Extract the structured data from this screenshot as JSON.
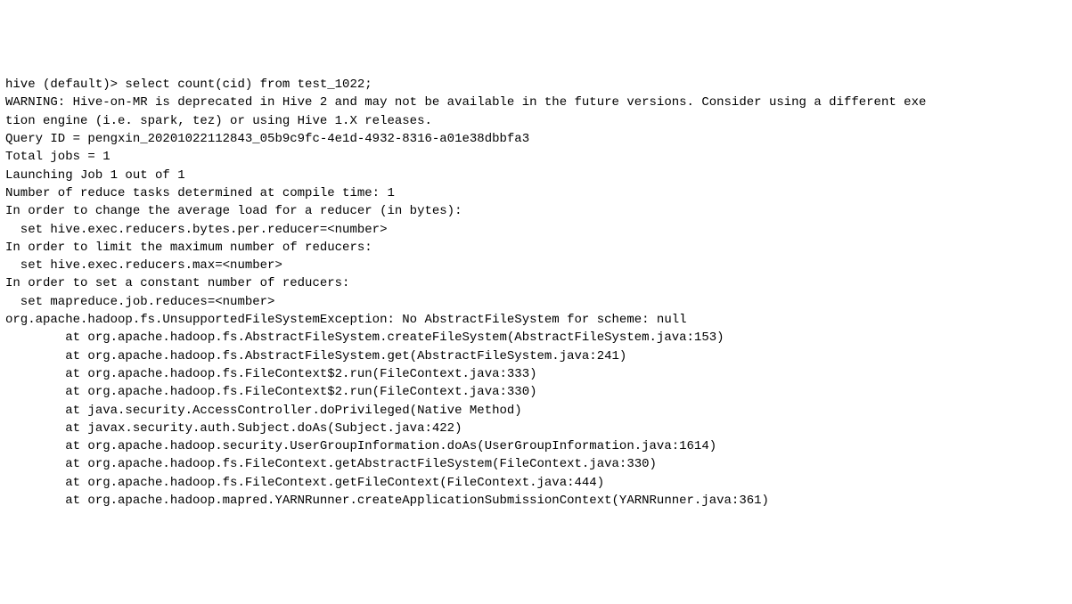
{
  "terminal": {
    "lines": [
      "hive (default)> select count(cid) from test_1022;",
      "WARNING: Hive-on-MR is deprecated in Hive 2 and may not be available in the future versions. Consider using a different exe",
      "tion engine (i.e. spark, tez) or using Hive 1.X releases.",
      "Query ID = pengxin_20201022112843_05b9c9fc-4e1d-4932-8316-a01e38dbbfa3",
      "Total jobs = 1",
      "Launching Job 1 out of 1",
      "Number of reduce tasks determined at compile time: 1",
      "In order to change the average load for a reducer (in bytes):",
      "  set hive.exec.reducers.bytes.per.reducer=<number>",
      "In order to limit the maximum number of reducers:",
      "  set hive.exec.reducers.max=<number>",
      "In order to set a constant number of reducers:",
      "  set mapreduce.job.reduces=<number>",
      "org.apache.hadoop.fs.UnsupportedFileSystemException: No AbstractFileSystem for scheme: null",
      "        at org.apache.hadoop.fs.AbstractFileSystem.createFileSystem(AbstractFileSystem.java:153)",
      "        at org.apache.hadoop.fs.AbstractFileSystem.get(AbstractFileSystem.java:241)",
      "        at org.apache.hadoop.fs.FileContext$2.run(FileContext.java:333)",
      "        at org.apache.hadoop.fs.FileContext$2.run(FileContext.java:330)",
      "        at java.security.AccessController.doPrivileged(Native Method)",
      "        at javax.security.auth.Subject.doAs(Subject.java:422)",
      "        at org.apache.hadoop.security.UserGroupInformation.doAs(UserGroupInformation.java:1614)",
      "        at org.apache.hadoop.fs.FileContext.getAbstractFileSystem(FileContext.java:330)",
      "        at org.apache.hadoop.fs.FileContext.getFileContext(FileContext.java:444)",
      "        at org.apache.hadoop.mapred.YARNRunner.createApplicationSubmissionContext(YARNRunner.java:361)"
    ]
  }
}
